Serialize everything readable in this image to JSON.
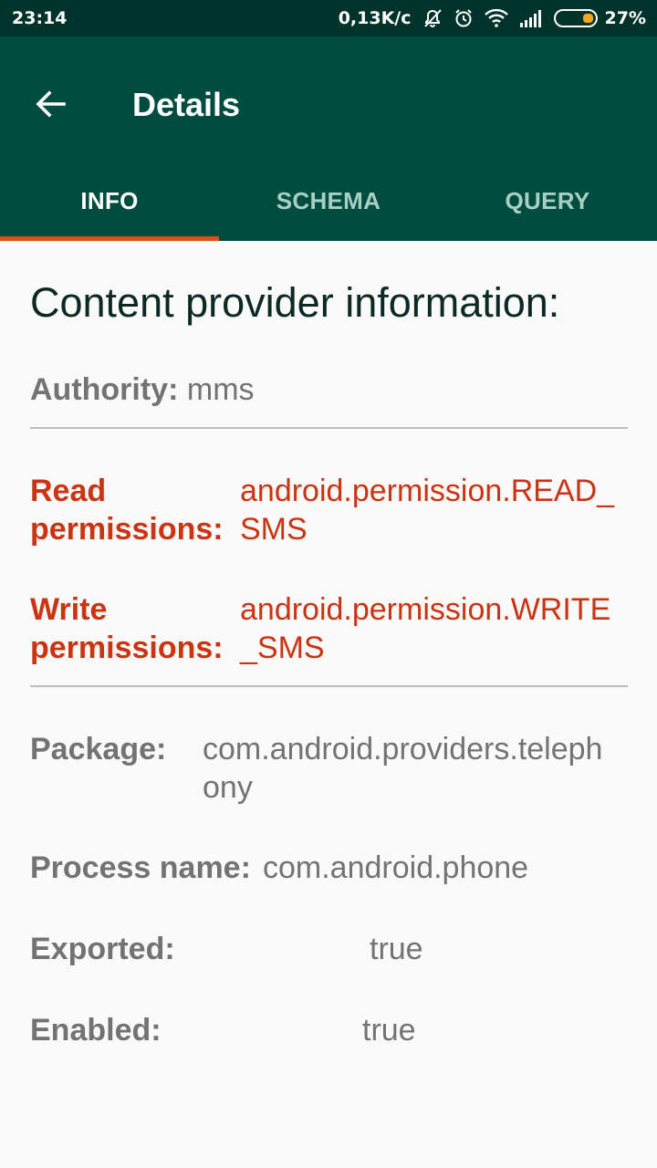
{
  "status_bar": {
    "time": "23:14",
    "network_speed": "0,13K/c",
    "battery_percent": "27%",
    "battery_level": 0.27,
    "icons": [
      "mute-icon",
      "alarm-icon",
      "wifi-icon",
      "signal-icon",
      "battery-icon"
    ]
  },
  "app_bar": {
    "back_icon": "arrow-back-icon",
    "title": "Details"
  },
  "tabs": [
    {
      "label": "INFO",
      "active": true
    },
    {
      "label": "SCHEMA",
      "active": false
    },
    {
      "label": "QUERY",
      "active": false
    }
  ],
  "content": {
    "heading": "Content provider information:",
    "authority": {
      "label": "Authority:",
      "value": "mms"
    },
    "read_permissions": {
      "label": "Read permissions:",
      "label_line1": "Read",
      "label_line2": "permissions:",
      "value_line1": "android.permission.READ_",
      "value_line2": "SMS"
    },
    "write_permissions": {
      "label": "Write permissions:",
      "label_line1": "Write",
      "label_line2": "permissions:",
      "value_line1": "android.permission.WRITE",
      "value_line2": "_SMS"
    },
    "package": {
      "label": "Package:",
      "value_line1": "com.android.providers.teleph",
      "value_line2": "ony"
    },
    "process_name": {
      "label": "Process name:",
      "value": "com.android.phone"
    },
    "exported": {
      "label": "Exported:",
      "value": "true"
    },
    "enabled": {
      "label": "Enabled:",
      "value": "true"
    }
  },
  "colors": {
    "status_bar": "#00342a",
    "app_bar": "#004d40",
    "tab_indicator": "#dd4c1f",
    "permission_text": "#cc3311",
    "label_text": "#737373"
  }
}
